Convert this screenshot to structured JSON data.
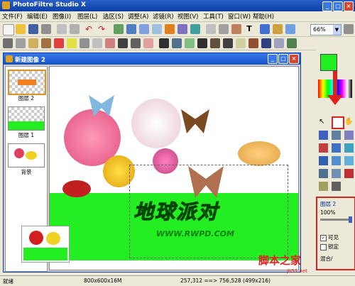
{
  "app": {
    "title": "PhotoFiltre Studio X"
  },
  "menu": [
    "文件(F)",
    "编辑(E)",
    "图像(I)",
    "图层(L)",
    "选区(S)",
    "调整(A)",
    "滤镜(R)",
    "视图(V)",
    "工具(T)",
    "窗口(W)",
    "帮助(H)"
  ],
  "toolbar": {
    "zoom": "66%"
  },
  "document": {
    "title": "新建图像 2",
    "layers": [
      "图层 2",
      "图层 1",
      "背景"
    ],
    "canvas_text": {
      "title": "地球派对",
      "url": "WWW.RWPD.COM"
    }
  },
  "colors": {
    "foreground": "#22ee22",
    "highlight": "#e02020"
  },
  "layer_props": {
    "name": "图层 2",
    "opacity": "100%",
    "visible_label": "可见",
    "visible_checked": true,
    "lock_label": "锁定",
    "lock_checked": false,
    "extra_label": "混合/"
  },
  "status": {
    "left": "就绪",
    "size": "800x600x16M",
    "coords": "257,312 ==> 756,528 (499x216)"
  },
  "watermark": {
    "main": "脚本之家",
    "sub": "jb51.net"
  }
}
